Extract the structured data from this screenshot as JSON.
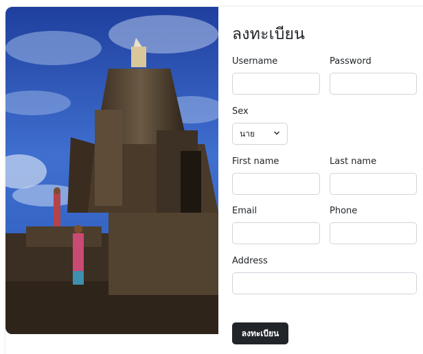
{
  "form": {
    "title": "ลงทะเบียน",
    "username_label": "Username",
    "password_label": "Password",
    "sex_label": "Sex",
    "sex_selected": "นาย",
    "firstname_label": "First name",
    "lastname_label": "Last name",
    "email_label": "Email",
    "phone_label": "Phone",
    "address_label": "Address",
    "submit_label": "ลงทะเบียน",
    "username_value": "",
    "password_value": "",
    "firstname_value": "",
    "lastname_value": "",
    "email_value": "",
    "phone_value": "",
    "address_value": ""
  },
  "icons": {
    "select_arrow": "chevron-down-icon"
  },
  "colors": {
    "button_bg": "#212529",
    "button_text": "#ffffff",
    "input_border": "#ced4da"
  }
}
